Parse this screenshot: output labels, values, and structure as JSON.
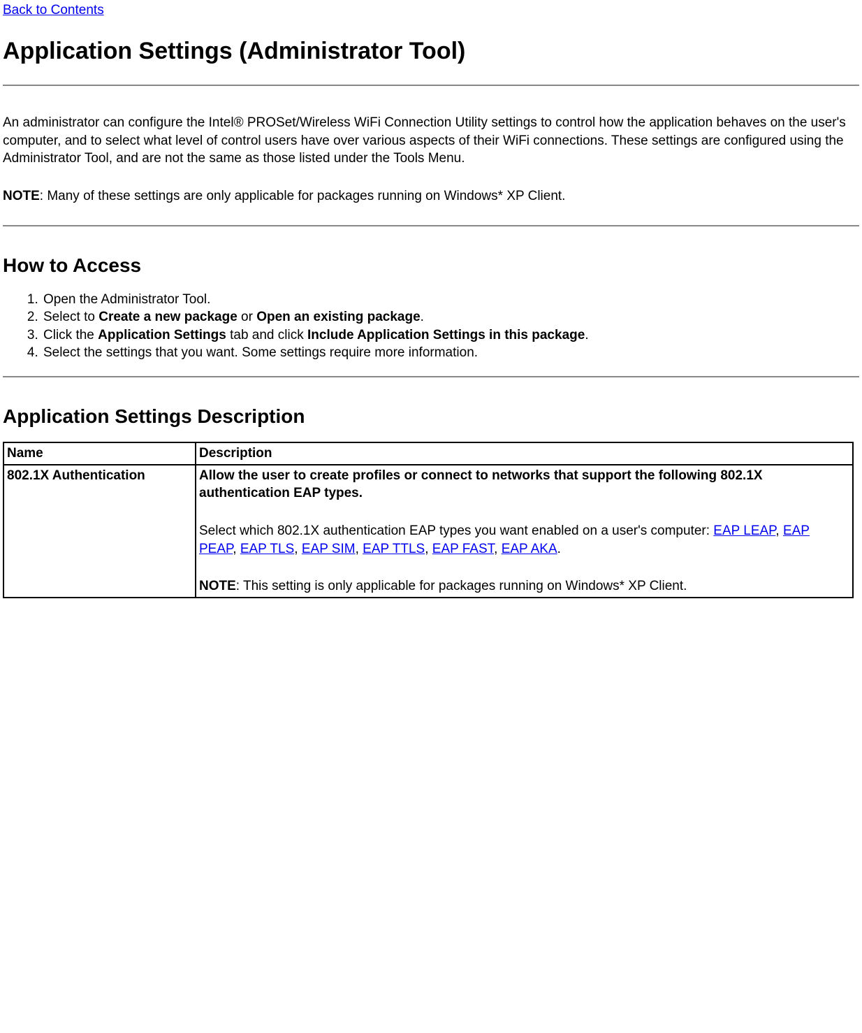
{
  "nav": {
    "back_link": "Back to Contents"
  },
  "page": {
    "title": "Application Settings (Administrator Tool)",
    "intro": "An administrator can configure the Intel® PROSet/Wireless WiFi Connection Utility settings to control how the application behaves on the user's computer, and to select what level of control users have over various aspects of their WiFi connections. These settings are configured using the Administrator Tool, and are not the same as those listed under the Tools Menu.",
    "note_label": "NOTE",
    "note_text": ": Many of these settings are only applicable for packages running on Windows* XP Client."
  },
  "section_access": {
    "heading": "How to Access",
    "items": [
      {
        "prefix": "Open the Administrator Tool."
      },
      {
        "prefix": "Select to ",
        "bold1": "Create a new package",
        "mid": " or ",
        "bold2": "Open an existing package",
        "suffix": "."
      },
      {
        "prefix": "Click the ",
        "bold1": "Application Settings",
        "mid": " tab and click ",
        "bold2": "Include Application Settings in this package",
        "suffix": "."
      },
      {
        "prefix": "Select the settings that you want. Some settings require more information."
      }
    ]
  },
  "section_desc": {
    "heading": "Application Settings Description",
    "table": {
      "header_name": "Name",
      "header_desc": "Description",
      "row1": {
        "name": "802.1X Authentication",
        "desc_bold": "Allow the user to create profiles or connect to networks that support the following 802.1X authentication EAP types.",
        "desc_pre": "Select which 802.1X authentication EAP types you want enabled on a user's computer: ",
        "links": [
          "EAP LEAP",
          "EAP PEAP",
          "EAP TLS",
          "EAP SIM",
          "EAP TTLS",
          "EAP FAST",
          "EAP AKA"
        ],
        "note_label": "NOTE",
        "note_text": ": This setting is only applicable for packages running on Windows* XP Client."
      }
    }
  }
}
